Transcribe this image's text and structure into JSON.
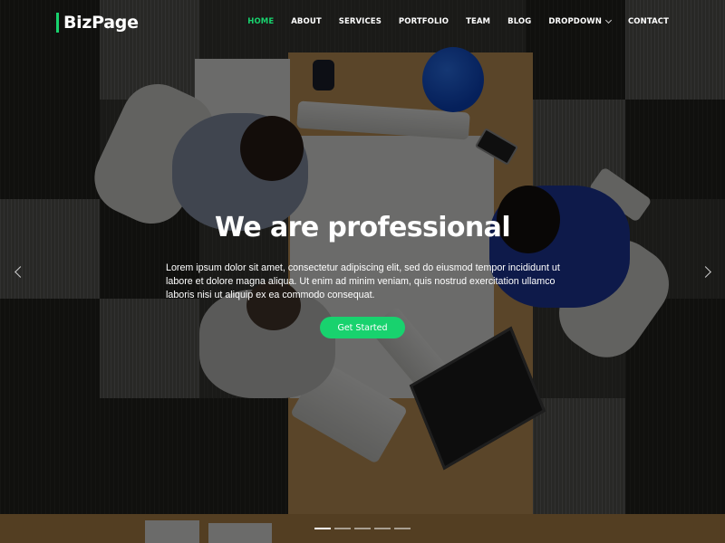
{
  "header": {
    "logo": "BizPage",
    "nav": [
      {
        "label": "HOME",
        "active": true
      },
      {
        "label": "ABOUT",
        "active": false
      },
      {
        "label": "SERVICES",
        "active": false
      },
      {
        "label": "PORTFOLIO",
        "active": false
      },
      {
        "label": "TEAM",
        "active": false
      },
      {
        "label": "BLOG",
        "active": false
      },
      {
        "label": "DROPDOWN",
        "active": false,
        "has_submenu": true
      },
      {
        "label": "CONTACT",
        "active": false
      }
    ]
  },
  "hero": {
    "title": "We are professional",
    "text": "Lorem ipsum dolor sit amet, consectetur adipiscing elit, sed do eiusmod tempor incididunt ut labore et dolore magna aliqua. Ut enim ad minim veniam, quis nostrud exercitation ullamco laboris nisi ut aliquip ex ea commodo consequat.",
    "cta_label": "Get Started",
    "slide_count": 5,
    "active_slide": 1
  },
  "icons": {
    "prev": "chevron-left-icon",
    "next": "chevron-right-icon",
    "dropdown": "chevron-down-icon"
  },
  "colors": {
    "accent": "#18d26e",
    "text": "#ffffff"
  }
}
